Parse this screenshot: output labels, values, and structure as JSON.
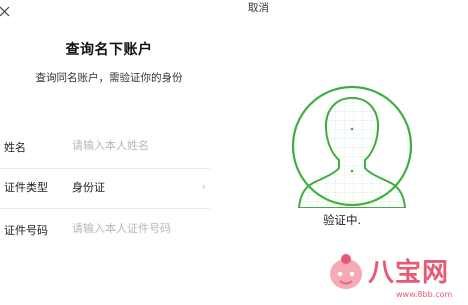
{
  "header": {
    "close_icon": "close-icon",
    "cancel_label": "取消"
  },
  "left": {
    "title": "查询名下账户",
    "subtitle": "查询同名账户，需验证你的身份",
    "fields": [
      {
        "label": "姓名",
        "placeholder": "请输入本人姓名",
        "value": ""
      },
      {
        "label": "证件类型",
        "value": "身份证",
        "chevron": "›"
      },
      {
        "label": "证件号码",
        "placeholder": "请输入本人证件号码",
        "value": ""
      }
    ]
  },
  "right": {
    "face_icon": "face-scan-icon",
    "accent_color": "#3fae3f",
    "status_text": "验证中."
  },
  "watermark": {
    "text": "八宝网",
    "url": "www.8bb.com",
    "color": "#e85a74"
  }
}
